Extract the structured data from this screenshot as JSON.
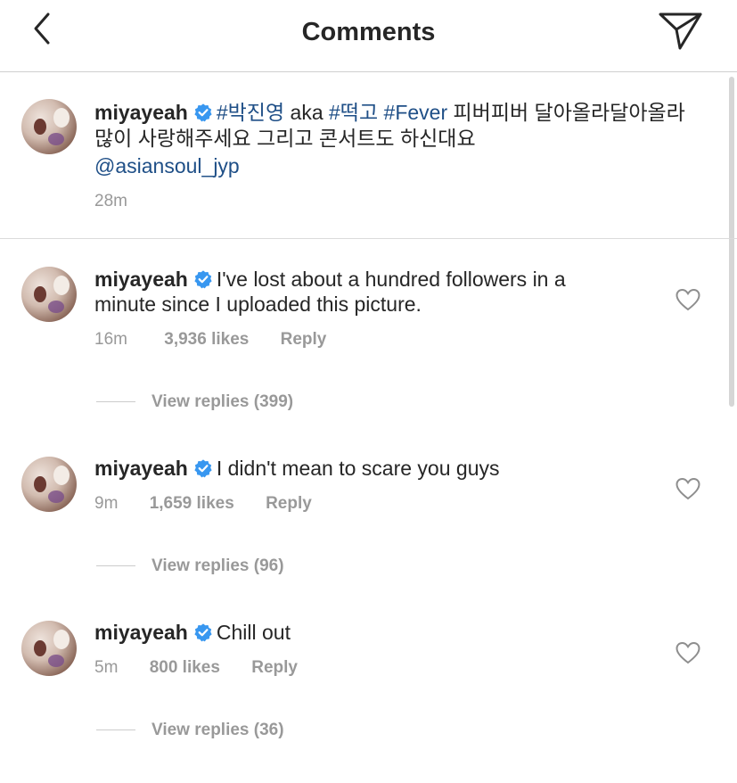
{
  "header": {
    "title": "Comments"
  },
  "caption": {
    "username": "miyayeah",
    "hashtag1": "#박진영",
    "text1": " aka ",
    "hashtag2": "#떡고",
    "hashtag3": "#Fever",
    "text2": " 피버피버 달아올라달아올라",
    "line2": "많이 사랑해주세요 그리고 콘서트도 하신대요",
    "mention": "@asiansoul_jyp",
    "time": "28m"
  },
  "comments": [
    {
      "username": "miyayeah",
      "text_line1": "I've lost about a hundred followers in a",
      "text_line2": "minute since I uploaded this picture.",
      "time": "16m",
      "likes": "3,936 likes",
      "reply_label": "Reply",
      "view_replies": "View replies (399)"
    },
    {
      "username": "miyayeah",
      "text_line1": "I didn't mean to scare you guys",
      "time": "9m",
      "likes": "1,659 likes",
      "reply_label": "Reply",
      "view_replies": "View replies (96)"
    },
    {
      "username": "miyayeah",
      "text_line1": "Chill out",
      "time": "5m",
      "likes": "800 likes",
      "reply_label": "Reply",
      "view_replies": "View replies (36)"
    }
  ],
  "icons": {
    "back": "chevron-left-icon",
    "share": "paper-plane-icon",
    "verified": "verified-badge-icon",
    "like": "heart-icon"
  },
  "colors": {
    "verified": "#3897f0",
    "hashtag": "#1f4f87",
    "meta": "#999999",
    "text": "#262626"
  }
}
